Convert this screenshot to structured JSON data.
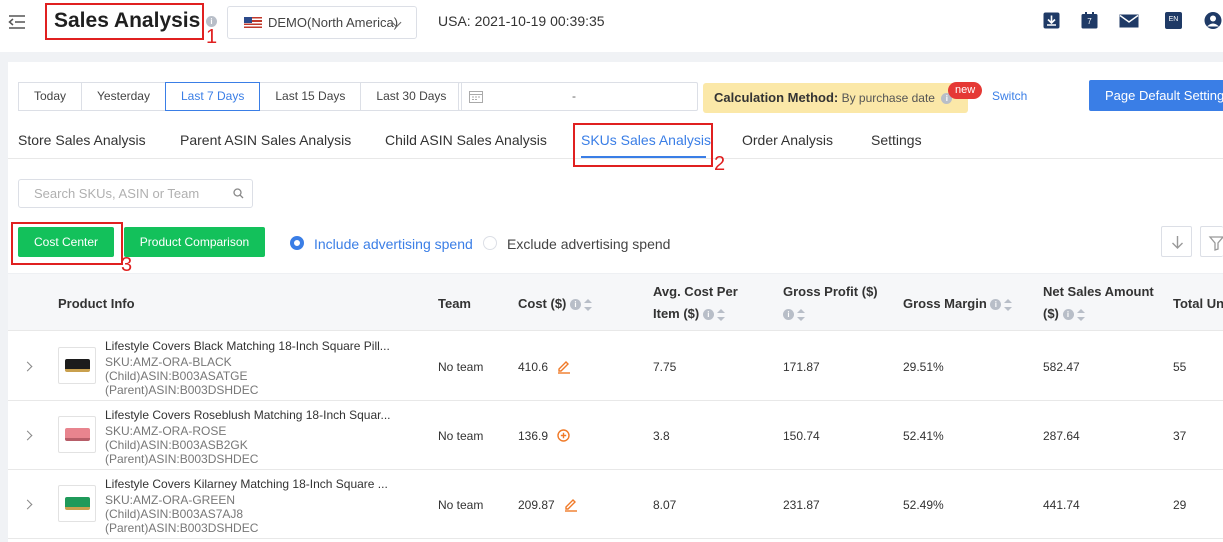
{
  "header": {
    "title": "Sales Analysis",
    "annotation_1": "1",
    "region": "DEMO(North America)",
    "time": "USA: 2021-10-19 00:39:35",
    "lang": "EN",
    "calendar_day": "7"
  },
  "date_filters": {
    "buttons": [
      "Today",
      "Yesterday",
      "Last 7 Days",
      "Last 15 Days",
      "Last 30 Days"
    ],
    "active": "Last 7 Days",
    "range_separator": "-"
  },
  "calc": {
    "label": "Calculation Method:",
    "value": "By purchase date",
    "badge": "new",
    "switch": "Switch"
  },
  "page_default": "Page Default Setting",
  "tabs": [
    "Store Sales Analysis",
    "Parent ASIN Sales Analysis",
    "Child ASIN Sales Analysis",
    "SKUs Sales Analysis",
    "Order Analysis",
    "Settings"
  ],
  "active_tab": "SKUs Sales Analysis",
  "annotation_2": "2",
  "search": {
    "placeholder": "Search SKUs, ASIN or Team"
  },
  "buttons": {
    "cost_center": "Cost Center",
    "product_comparison": "Product Comparison"
  },
  "annotation_3": "3",
  "advertising": {
    "include": "Include advertising spend",
    "exclude": "Exclude advertising spend",
    "selected": "include"
  },
  "table": {
    "headers": {
      "product_info": "Product Info",
      "team": "Team",
      "cost": "Cost ($)",
      "avg_cost_1": "Avg. Cost Per",
      "avg_cost_2": "Item ($)",
      "gross_profit": "Gross Profit ($)",
      "gross_margin": "Gross Margin",
      "net_sales_1": "Net Sales Amount",
      "net_sales_2": "($)",
      "total_units": "Total Un"
    },
    "rows": [
      {
        "name": "Lifestyle Covers Black Matching 18-Inch Square Pill...",
        "sku": "SKU:AMZ-ORA-BLACK",
        "child": "(Child)ASIN:B003ASATGE",
        "parent": "(Parent)ASIN:B003DSHDEC",
        "team": "No team",
        "cost": "410.6",
        "cost_icon": "edit-icon",
        "avg_cost": "7.75",
        "gross_profit": "171.87",
        "gross_margin": "29.51%",
        "net_sales": "582.47",
        "total_units": "55",
        "color": "#1c1c1c"
      },
      {
        "name": "Lifestyle Covers Roseblush Matching 18-Inch Squar...",
        "sku": "SKU:AMZ-ORA-ROSE",
        "child": "(Child)ASIN:B003ASB2GK",
        "parent": "(Parent)ASIN:B003DSHDEC",
        "team": "No team",
        "cost": "136.9",
        "cost_icon": "add-circle-icon",
        "avg_cost": "3.8",
        "gross_profit": "150.74",
        "gross_margin": "52.41%",
        "net_sales": "287.64",
        "total_units": "37",
        "color": "#e8848e"
      },
      {
        "name": "Lifestyle Covers Kilarney Matching 18-Inch Square ...",
        "sku": "SKU:AMZ-ORA-GREEN",
        "child": "(Child)ASIN:B003AS7AJ8",
        "parent": "(Parent)ASIN:B003DSHDEC",
        "team": "No team",
        "cost": "209.87",
        "cost_icon": "edit-icon",
        "avg_cost": "8.07",
        "gross_profit": "231.87",
        "gross_margin": "52.49%",
        "net_sales": "441.74",
        "total_units": "29",
        "color": "#1f9a5a"
      }
    ]
  },
  "colors": {
    "accent": "#3a7ee6",
    "green": "#13c15b",
    "annotation": "#e02020",
    "calc_bg": "#fbe8a8"
  }
}
